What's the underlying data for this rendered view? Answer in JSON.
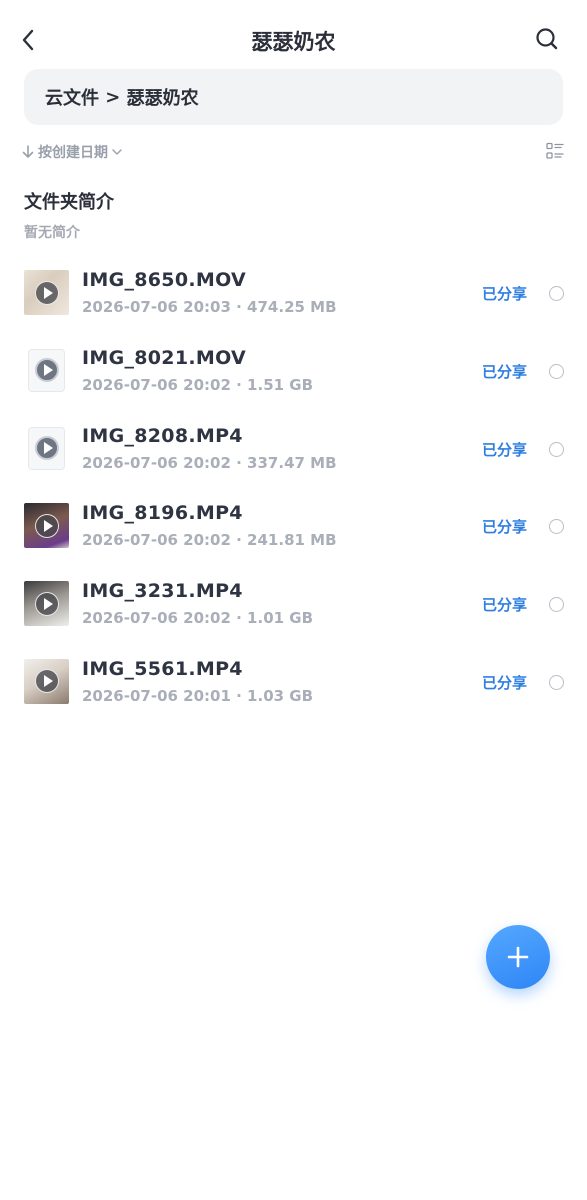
{
  "header": {
    "title": "瑟瑟奶农"
  },
  "breadcrumb": {
    "root": "云文件",
    "separator": " > ",
    "current": "瑟瑟奶农"
  },
  "sort": {
    "label": "按创建日期"
  },
  "intro": {
    "title": "文件夹简介",
    "text": "暂无简介"
  },
  "files": [
    {
      "name": "IMG_8650.MOV",
      "meta": "2026-07-06 20:03 · 474.25 MB",
      "status": "已分享",
      "thumb": "photo"
    },
    {
      "name": "IMG_8021.MOV",
      "meta": "2026-07-06 20:02 · 1.51 GB",
      "status": "已分享",
      "thumb": "video-file-icon"
    },
    {
      "name": "IMG_8208.MP4",
      "meta": "2026-07-06 20:02 · 337.47 MB",
      "status": "已分享",
      "thumb": "video-file-icon"
    },
    {
      "name": "IMG_8196.MP4",
      "meta": "2026-07-06 20:02 · 241.81 MB",
      "status": "已分享",
      "thumb": "photo"
    },
    {
      "name": "IMG_3231.MP4",
      "meta": "2026-07-06 20:02 · 1.01 GB",
      "status": "已分享",
      "thumb": "photo"
    },
    {
      "name": "IMG_5561.MP4",
      "meta": "2026-07-06 20:01 · 1.03 GB",
      "status": "已分享",
      "thumb": "photo"
    }
  ],
  "colors": {
    "accent": "#2f7fe0",
    "fab": "#3a8ff7",
    "title_text": "#2b2f3a",
    "secondary_text": "#a9aeb8",
    "breadcrumb_bg": "#f2f3f5"
  },
  "icons": {
    "back": "chevron-left-icon",
    "search": "search-icon",
    "sort": "arrow-down-icon",
    "sort_dropdown": "chevron-down-icon",
    "view_toggle": "list-view-icon",
    "play": "play-icon",
    "add": "plus-icon"
  }
}
